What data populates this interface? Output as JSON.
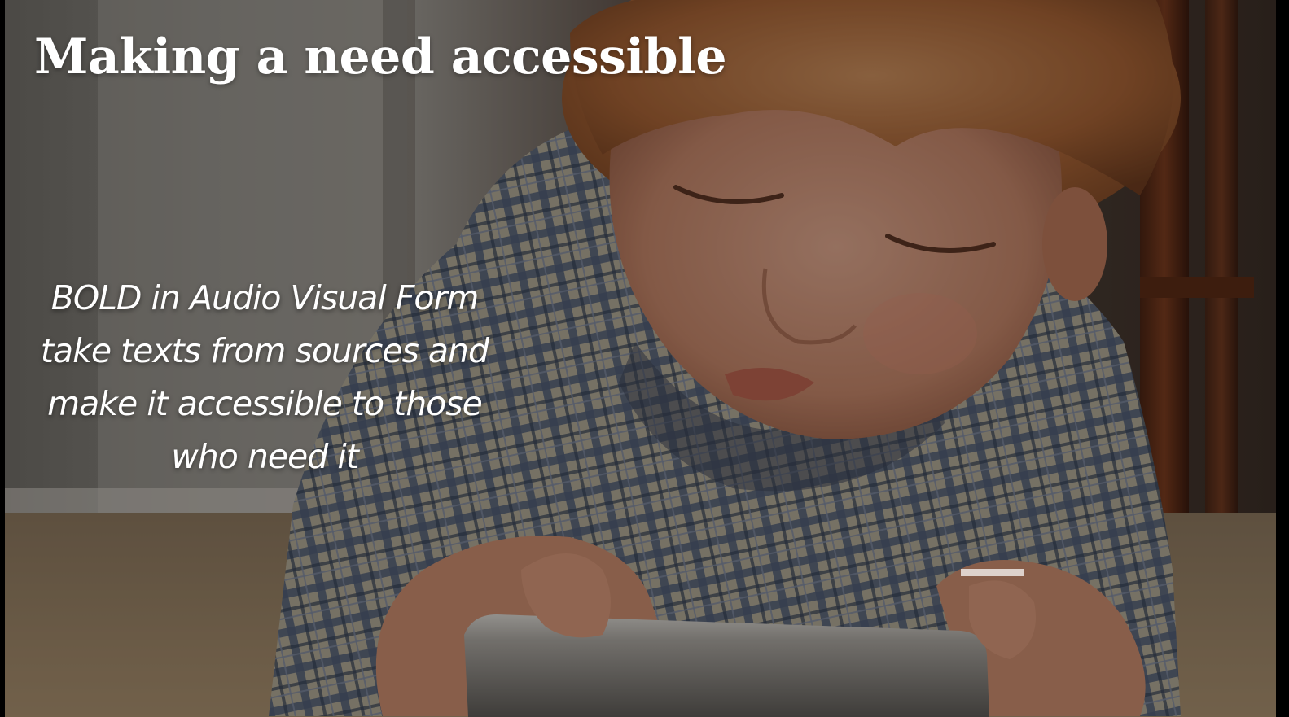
{
  "slide": {
    "title": "Making a need accessible",
    "body_lines": [
      "BOLD in Audio Visual Form",
      "take texts from sources and",
      "make it  accessible to those",
      "who need it"
    ]
  },
  "colors": {
    "text": "#ffffff",
    "overlay": "rgba(0,0,0,0.32)",
    "wall": "#8b877f",
    "carpet": "#8a7458",
    "hair": "#b4713f",
    "skin": "#c98f75",
    "shirt_blue": "#5b6a84",
    "shirt_cream": "#cfc6b0",
    "phone": "#a9a5a0"
  }
}
